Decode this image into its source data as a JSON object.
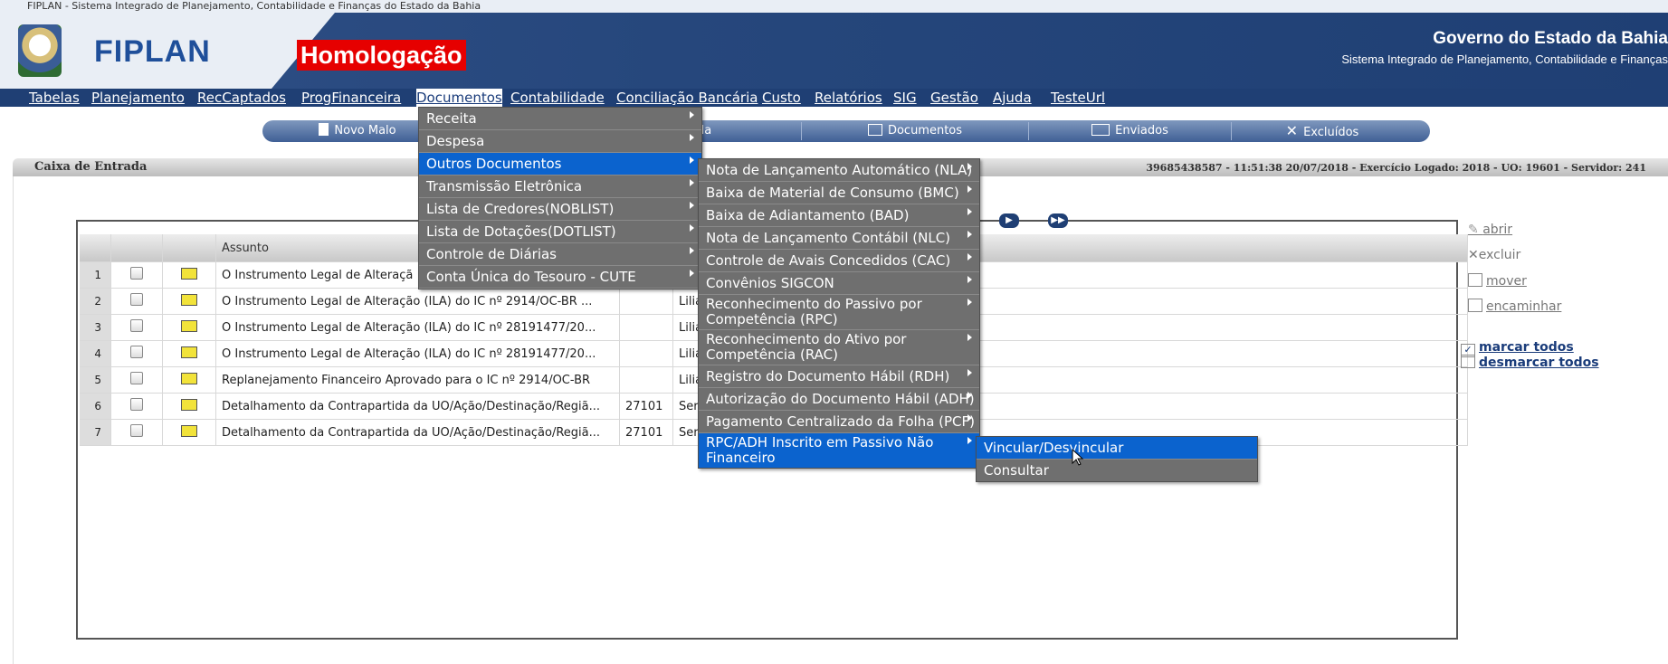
{
  "window": {
    "title": "FIPLAN - Sistema Integrado de Planejamento, Contabilidade e Finanças do Estado da Bahia"
  },
  "header": {
    "logo_text": "FIPLAN",
    "environment_badge": "Homologação",
    "gov_title": "Governo do Estado da Bahia",
    "gov_subtitle": "Sistema Integrado de Planejamento, Contabilidade e Finanças"
  },
  "menubar": [
    "Tabelas",
    "Planejamento",
    "RecCaptados",
    "ProgFinanceira",
    "Documentos",
    "Contabilidade",
    "Conciliação Bancária",
    "Custo",
    "Relatórios",
    "SIG",
    "Gestão",
    "Ajuda",
    "TesteUrl"
  ],
  "toolbar": {
    "novo_malote": "Novo Malo",
    "caixa_entrada": "da",
    "documentos": "Documentos",
    "enviados": "Enviados",
    "excluidos": "Excluídos"
  },
  "section": {
    "title": "Caixa de Entrada",
    "info": "39685438587 - 11:51:38 20/07/2018 - Exercício Logado: 2018 - UO: 19601 - Servidor: 241"
  },
  "grid": {
    "header_subject": "Assunto",
    "rows": [
      {
        "num": "1",
        "subject": "O Instrumento Legal de Alteraçã",
        "code": "",
        "from": ""
      },
      {
        "num": "2",
        "subject": "O Instrumento Legal de Alteração (ILA) do IC nº 2914/OC-BR ...",
        "code": "",
        "from": "Liliar"
      },
      {
        "num": "3",
        "subject": "O Instrumento Legal de Alteração (ILA) do IC nº 28191477/20...",
        "code": "",
        "from": "Liliar"
      },
      {
        "num": "4",
        "subject": "O Instrumento Legal de Alteração (ILA) do IC nº 28191477/20...",
        "code": "",
        "from": "Liliar"
      },
      {
        "num": "5",
        "subject": "Replanejamento Financeiro Aprovado para o IC nº 2914/OC-BR",
        "code": "",
        "from": "Liliar"
      },
      {
        "num": "6",
        "subject": "Detalhamento da Contrapartida da UO/Ação/Destinação/Regiã...",
        "code": "27101",
        "from": "Serg"
      },
      {
        "num": "7",
        "subject": "Detalhamento da Contrapartida da UO/Ação/Destinação/Regiã...",
        "code": "27101",
        "from": "Serg"
      }
    ]
  },
  "actions": {
    "abrir": "abrir",
    "excluir": "excluir",
    "mover": "mover",
    "encaminhar": "encaminhar",
    "marcar_todos": "marcar todos",
    "desmarcar_todos": "desmarcar todos"
  },
  "menu_documentos": [
    "Receita",
    "Despesa",
    "Outros Documentos",
    "Transmissão Eletrônica",
    "Lista de Credores(NOBLIST)",
    "Lista de Dotações(DOTLIST)",
    "Controle de Diárias",
    "Conta Única do Tesouro - CUTE"
  ],
  "menu_outros": [
    "Nota de Lançamento Automático (NLA)",
    "Baixa de Material de Consumo (BMC)",
    "Baixa de Adiantamento (BAD)",
    "Nota de Lançamento Contábil (NLC)",
    "Controle de Avais Concedidos (CAC)",
    "Convênios SIGCON",
    "Reconhecimento do Passivo por Competência (RPC)",
    "Reconhecimento do Ativo por Competência (RAC)",
    "Registro do Documento Hábil (RDH)",
    "Autorização do Documento Hábil (ADH)",
    "Pagamento Centralizado da Folha (PCF)",
    "RPC/ADH Inscrito em Passivo Não Financeiro"
  ],
  "menu_rpc": [
    "Vincular/Desvincular",
    "Consultar"
  ],
  "colors": {
    "header_blue": "#1f3f74",
    "menu_gray": "#6f6f6f",
    "highlight_blue": "#0b63ce",
    "badge_red": "#e60000"
  }
}
